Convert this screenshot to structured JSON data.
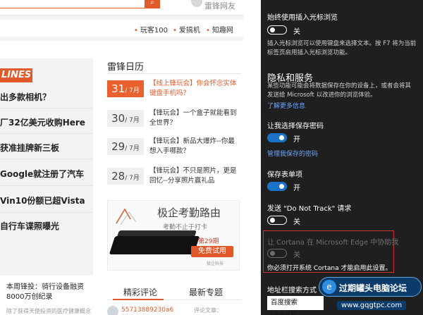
{
  "site": {
    "user_name": "雷锋网友",
    "nav_links": [
      "玩客100",
      "爱搞机",
      "知趣网"
    ],
    "headlines_banner": "LINES",
    "headlines": [
      "出多款相机？",
      "厂32亿美元收购Here",
      "获准挂牌新三板",
      "Google就注册了汽车",
      "Vin10份额已超Vista",
      "自行车谍照曝光"
    ],
    "brief_title": "本周锋投：骑行设备融资8000万创纪录",
    "brief_sub": "除了获得天使投资的医疗健康概念",
    "calendar_title": "雷锋日历",
    "calendar": [
      {
        "day": "31",
        "month": "/ 7月",
        "text": "【线上锋玩会】你会怀念实体键盘手机吗？",
        "active": true
      },
      {
        "day": "30",
        "month": "/ 7月",
        "text": "【锋玩会】一个盒子就能看到全世界？",
        "active": false
      },
      {
        "day": "29",
        "month": "/ 7月",
        "text": "【锋玩会】新品大爆炸--你最想入手哪款？",
        "active": false
      },
      {
        "day": "28",
        "month": "/ 7月",
        "text": "【锋玩会】不只是照片，更是回忆--分享照片赢礼品",
        "active": false
      }
    ],
    "ad": {
      "title": "极企考勤路由",
      "subtitle": "考勤不止于打卡",
      "period": "第29期",
      "cta": "免费试用",
      "logo": "极企科技"
    },
    "tabs": [
      "精彩评论",
      "最新专题"
    ],
    "comment_user": "55713889230a6",
    "comment_label": "评论文章："
  },
  "settings": {
    "caret_label": "始终使用插入光标浏览",
    "caret_state": "关",
    "caret_desc": "插入光标浏览可以使用键盘来选择文本。按 F7 将为当前标签页启用插入光标浏览功能。",
    "privacy_heading": "隐私和服务",
    "privacy_desc": "某些功能可能会将数据保存在你的设备上，或者会将其发送给 Microsoft 以改进你的浏览体验。",
    "learn_more": "了解更多信息",
    "save_pw_label": "让我选择保存密码",
    "save_pw_state": "开",
    "manage_pw_link": "管理我保存的密码",
    "form_label": "保存表单项",
    "form_state": "开",
    "dnt_label": "发送 \"Do Not Track\" 请求",
    "dnt_state": "关",
    "cortana_label": "让 Cortana 在 Microsoft Edge 中协助我",
    "cortana_state": "关",
    "cortana_warn": "你必须打开系统 Cortana 才能启用此设置。",
    "search_label": "地址栏搜索方式",
    "search_value": "百度搜索 (www.b"
  },
  "watermark": {
    "text": "过期罐头电脑论坛",
    "url": "www.gqgtpc.com"
  }
}
